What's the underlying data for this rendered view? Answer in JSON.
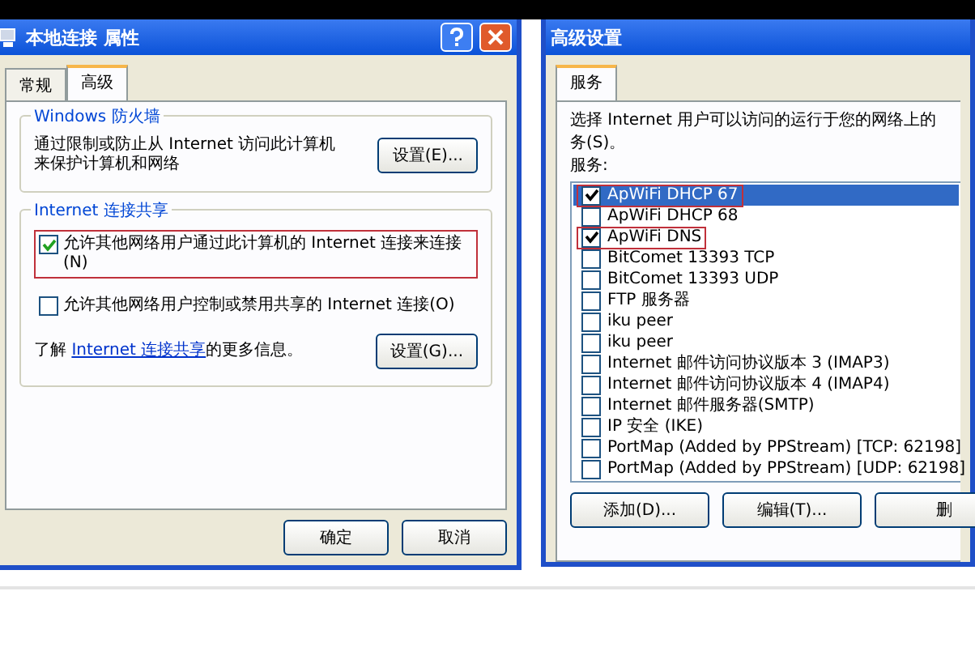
{
  "properties_window": {
    "title": "本地连接 属性",
    "tabs": [
      {
        "label": "常规",
        "selected": false
      },
      {
        "label": "高级",
        "selected": true
      }
    ],
    "firewall_group": {
      "title": "Windows 防火墙",
      "text": "通过限制或防止从 Internet 访问此计算机来保护计算机和网络",
      "button": "设置(E)..."
    },
    "sharing_group": {
      "title": "Internet 连接共享",
      "options": [
        {
          "label": "允许其他网络用户通过此计算机的 Internet 连接来连接(N)",
          "checked": true,
          "highlighted": true
        },
        {
          "label": "允许其他网络用户控制或禁用共享的 Internet 连接(O)",
          "checked": false,
          "highlighted": false
        }
      ],
      "info_before": "了解",
      "info_link": "Internet 连接共享",
      "info_after": "的更多信息。",
      "button": "设置(G)..."
    },
    "buttons": [
      "确定",
      "取消"
    ]
  },
  "advanced_window": {
    "title": "高级设置",
    "tabs": [
      {
        "label": "服务",
        "selected": true
      }
    ],
    "description_lines": [
      "选择 Internet 用户可以访问的运行于您的网络上的",
      "务(S)。"
    ],
    "list_label": "服务:",
    "services": [
      {
        "label": "ApWiFi DHCP 67",
        "checked": true,
        "selected": true,
        "highlighted": true
      },
      {
        "label": "ApWiFi DHCP 68",
        "checked": false,
        "selected": false,
        "highlighted": false
      },
      {
        "label": "ApWiFi DNS",
        "checked": true,
        "selected": false,
        "highlighted": true
      },
      {
        "label": "BitComet 13393 TCP",
        "checked": false,
        "selected": false,
        "highlighted": false
      },
      {
        "label": "BitComet 13393 UDP",
        "checked": false,
        "selected": false,
        "highlighted": false
      },
      {
        "label": "FTP 服务器",
        "checked": false,
        "selected": false,
        "highlighted": false
      },
      {
        "label": "iku peer",
        "checked": false,
        "selected": false,
        "highlighted": false
      },
      {
        "label": "iku peer",
        "checked": false,
        "selected": false,
        "highlighted": false
      },
      {
        "label": "Internet 邮件访问协议版本 3 (IMAP3)",
        "checked": false,
        "selected": false,
        "highlighted": false
      },
      {
        "label": "Internet 邮件访问协议版本 4 (IMAP4)",
        "checked": false,
        "selected": false,
        "highlighted": false
      },
      {
        "label": "Internet 邮件服务器(SMTP)",
        "checked": false,
        "selected": false,
        "highlighted": false
      },
      {
        "label": "IP 安全 (IKE)",
        "checked": false,
        "selected": false,
        "highlighted": false
      },
      {
        "label": "PortMap (Added by PPStream) [TCP: 62198]",
        "checked": false,
        "selected": false,
        "highlighted": false
      },
      {
        "label": "PortMap (Added by PPStream) [UDP: 62198]",
        "checked": false,
        "selected": false,
        "highlighted": false
      }
    ],
    "buttons": [
      "添加(D)...",
      "编辑(T)...",
      "删"
    ]
  }
}
